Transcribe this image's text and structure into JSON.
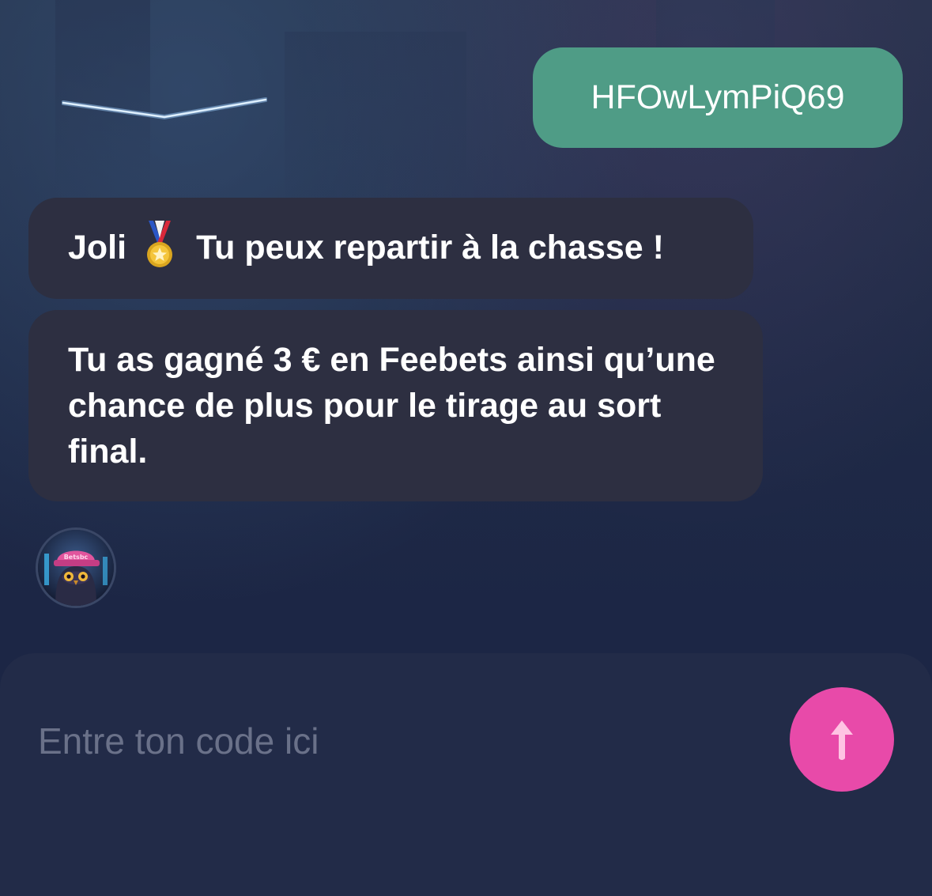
{
  "conversation": {
    "user_message": "HFOwLymPiQ69",
    "bot_messages": [
      {
        "before_icon": "Joli",
        "icon": "medal-icon",
        "after_icon": "Tu peux repartir à la chasse !"
      },
      {
        "text": "Tu as gagné 3 € en Feebets ainsi qu’une chance de plus pour le tirage au sort final."
      }
    ],
    "avatar": {
      "icon": "owl-cap-avatar",
      "cap_text": "Betsbc"
    }
  },
  "composer": {
    "placeholder": "Entre ton code ici",
    "value": "",
    "send_icon": "arrow-up-icon"
  },
  "colors": {
    "user_bubble": "#4f9c86",
    "bot_bubble": "#2d2f41",
    "send_button": "#e84aa9",
    "background": "#1d2744",
    "placeholder": "#6a7189"
  }
}
